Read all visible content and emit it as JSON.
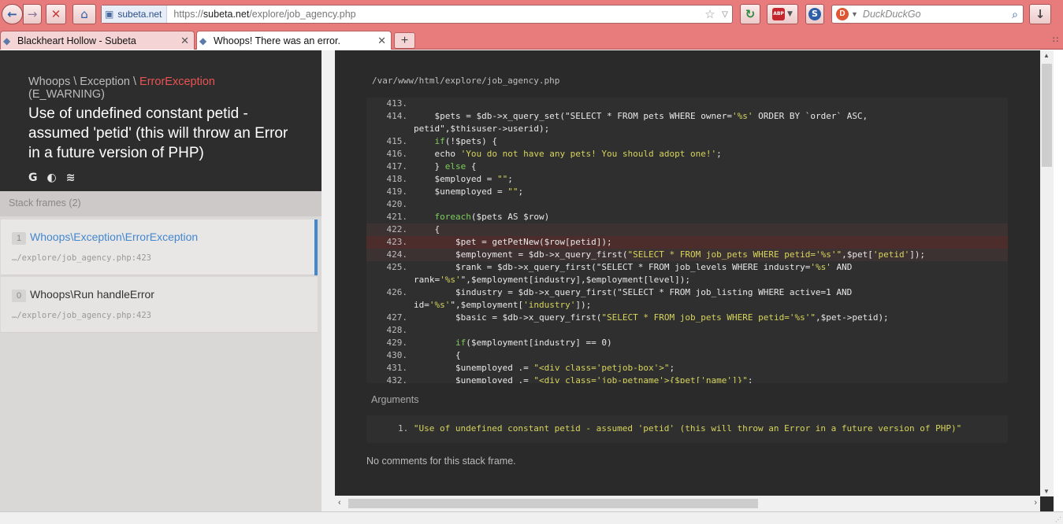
{
  "browser": {
    "url_domain": "subeta.net",
    "url_prefix": "https://",
    "url_host": "subeta.net",
    "url_path": "/explore/job_agency.php",
    "search_placeholder": "DuckDuckGo",
    "icons": {
      "back": "back-arrow-icon",
      "forward": "forward-arrow-icon",
      "stop": "stop-icon",
      "home": "home-icon",
      "reload": "reload-icon",
      "star": "bookmark-star-icon",
      "adblock": "adblock-icon",
      "download": "download-icon"
    }
  },
  "tabs": [
    {
      "label": "Blackheart Hollow - Subeta"
    },
    {
      "label": "Whoops! There was an error."
    }
  ],
  "newtab_label": "+",
  "exception": {
    "prefix": "Whoops \\ Exception \\ ",
    "class": "ErrorException",
    "suffix": " (E_WARNING)",
    "message": "Use of undefined constant petid - assumed 'petid' (this will throw an Error in a future version of PHP)",
    "icon_google": "G",
    "icon_ddg": "◐",
    "icon_so": "≋"
  },
  "frames_label": "Stack frames (2)",
  "frames": [
    {
      "index": "1",
      "class": "Whoops\\Exception\\ErrorException",
      "file": "…/explore/job_agency.php:423"
    },
    {
      "index": "0",
      "class": "Whoops\\Run handleError",
      "file": "…/explore/job_agency.php:423"
    }
  ],
  "file_path": "/var/www/html/explore/job_agency.php",
  "code_lines": [
    {
      "n": "413.",
      "c": ""
    },
    {
      "n": "414.",
      "c": "    $pets = $db->x_query_set(\"SELECT * FROM pets WHERE owner='%s' ORDER BY `order` ASC,"
    },
    {
      "n": "",
      "c": "petid\",$thisuser->userid);"
    },
    {
      "n": "415.",
      "c": "    if(!$pets) {"
    },
    {
      "n": "416.",
      "c": "    echo 'You do not have any pets! You should adopt one!';"
    },
    {
      "n": "417.",
      "c": "    } else {"
    },
    {
      "n": "418.",
      "c": "    $employed = \"\";"
    },
    {
      "n": "419.",
      "c": "    $unemployed = \"\";"
    },
    {
      "n": "420.",
      "c": ""
    },
    {
      "n": "421.",
      "c": "    foreach($pets AS $row)"
    },
    {
      "n": "422.",
      "c": "    {"
    },
    {
      "n": "423.",
      "c": "        $pet = getPetNew($row[petid]);"
    },
    {
      "n": "424.",
      "c": "        $employment = $db->x_query_first(\"SELECT * FROM job_pets WHERE petid='%s'\",$pet['petid']);"
    },
    {
      "n": "425.",
      "c": "        $rank = $db->x_query_first(\"SELECT * FROM job_levels WHERE industry='%s' AND"
    },
    {
      "n": "",
      "c": "rank='%s'\",$employment[industry],$employment[level]);"
    },
    {
      "n": "426.",
      "c": "        $industry = $db->x_query_first(\"SELECT * FROM job_listing WHERE active=1 AND"
    },
    {
      "n": "",
      "c": "id='%s'\",$employment['industry']);"
    },
    {
      "n": "427.",
      "c": "        $basic = $db->x_query_first(\"SELECT * FROM job_pets WHERE petid='%s'\",$pet->petid);"
    },
    {
      "n": "428.",
      "c": ""
    },
    {
      "n": "429.",
      "c": "        if($employment[industry] == 0)"
    },
    {
      "n": "430.",
      "c": "        {"
    },
    {
      "n": "431.",
      "c": "        $unemployed .= \"<div class='petjob-box'>\";"
    },
    {
      "n": "432.",
      "c": "        $unemployed .= \"<div class='job-petname'>{$pet['name']}\";"
    }
  ],
  "args_label": "Arguments",
  "args": [
    {
      "num": "1.",
      "value": "\"Use of undefined constant petid - assumed 'petid' (this will throw an Error in a future version of PHP)\""
    }
  ],
  "no_comments": "No comments for this stack frame."
}
